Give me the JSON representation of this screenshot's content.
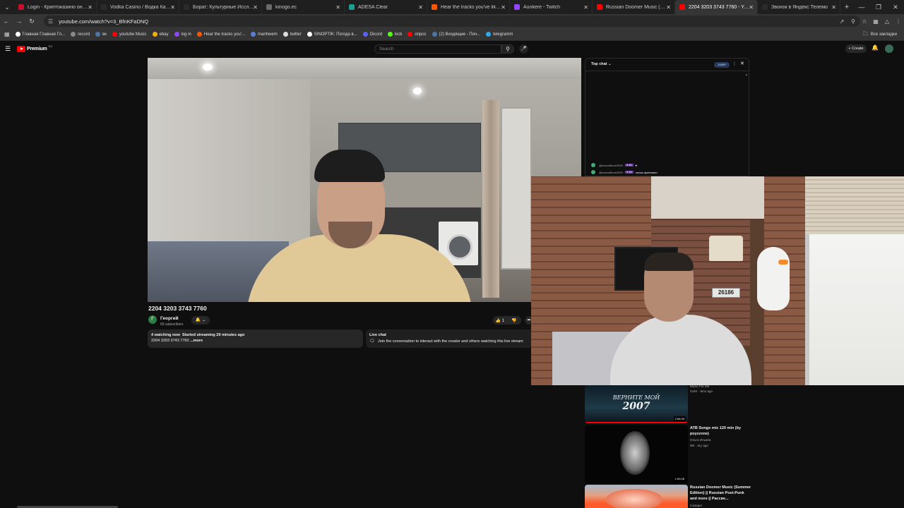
{
  "browser": {
    "tabs": [
      {
        "title": "Login - Криптоказино онлай",
        "color": "#c8102e",
        "active": false
      },
      {
        "title": "Vodka Casino / Водка Казино",
        "color": "#2b2b2b",
        "active": false
      },
      {
        "title": "Борат: Культурные Исследов",
        "color": "#2b2b2b",
        "active": false
      },
      {
        "title": "kinogo.ec",
        "color": "#6b6b6b",
        "active": false
      },
      {
        "title": "ADESA Clear",
        "color": "#1a9e8f",
        "active": false
      },
      {
        "title": "Hear the tracks you've liked: o",
        "color": "#ff5500",
        "active": false
      },
      {
        "title": "Aunkere - Twitch",
        "color": "#9146ff",
        "active": false
      },
      {
        "title": "Russian Doomer Music (Sumn",
        "color": "#ff0000",
        "active": false
      },
      {
        "title": "2204 3203 3743 7760 - YouTu",
        "color": "#ff0000",
        "active": true
      },
      {
        "title": "Звонок в Яндекс Телемо",
        "color": "#2b2b2b",
        "active": false
      }
    ],
    "url": "youtube.com/watch?v=3_BfnKFaDNQ",
    "bookmarks": [
      {
        "label": "Главная Главная Гл...",
        "color": "#ffffff"
      },
      {
        "label": "record",
        "color": "#888888"
      },
      {
        "label": "вк",
        "color": "#4a76a8"
      },
      {
        "label": "youtube Music",
        "color": "#ff0000"
      },
      {
        "label": "ebay",
        "color": "#f5af02"
      },
      {
        "label": "log in",
        "color": "#9146ff"
      },
      {
        "label": "Hear the tracks you'...",
        "color": "#ff5500"
      },
      {
        "label": "manhwem",
        "color": "#5b7fd6"
      },
      {
        "label": "twitter",
        "color": "#dddddd"
      },
      {
        "label": "SINOPTIK: Погода в...",
        "color": "#ffffff"
      },
      {
        "label": "Dicord",
        "color": "#5865f2"
      },
      {
        "label": "kick",
        "color": "#53fc18"
      },
      {
        "label": "опрос",
        "color": "#ff0000"
      },
      {
        "label": "(2) Входящие - Поч...",
        "color": "#4a76a8"
      },
      {
        "label": "telegramm",
        "color": "#2aabee"
      }
    ],
    "bookmarks_all": "Все закладки"
  },
  "youtube": {
    "logo_text": "Premium",
    "logo_region": "RU",
    "search_placeholder": "Search",
    "create_label": "Create",
    "video": {
      "title": "2204 3203 3743 7760",
      "channel_initial": "Г",
      "channel_name": "Георгий",
      "subscribers": "69 subscribers",
      "like_count": "1",
      "watching": "4 watching now",
      "started": "Started streaming 29 minutes ago",
      "desc_text": "2204 3203 3743 7760",
      "more_label": "...more"
    },
    "livechat_box": {
      "title": "Live chat",
      "text": "Join the conversation to interact with the creator and others watching this live stream"
    },
    "chat_panel": {
      "mode": "Top chat",
      "quality": "1080P",
      "messages": [
        {
          "user": "@marco8lone2099",
          "badge": "✦ #1",
          "text": "♥"
        },
        {
          "user": "@marco8lone2099",
          "badge": "✦ #2",
          "text": "сынок жреномно"
        }
      ]
    },
    "pip": {
      "plate": "26186"
    },
    "recommended": [
      {
        "title": "",
        "channel": "Music For Me",
        "meta": "244K · 8mo ago",
        "duration": "2:56:39",
        "thumb_text": "ВЕРНИТЕ МОЙ",
        "thumb_year": "2007",
        "progress": 1.0
      },
      {
        "title": "ATB Songs mix 120 min (by poyzzone)",
        "channel": "Ольга Ильина",
        "meta": "9M · 11y ago",
        "duration": "1:59:28",
        "progress": 0
      },
      {
        "title": "Russian Doomer Music (Summer Edition) || Russian Post-Punk and more || Рассве...",
        "channel": "mixtaper",
        "meta": "",
        "duration": "",
        "progress": 0
      }
    ]
  }
}
